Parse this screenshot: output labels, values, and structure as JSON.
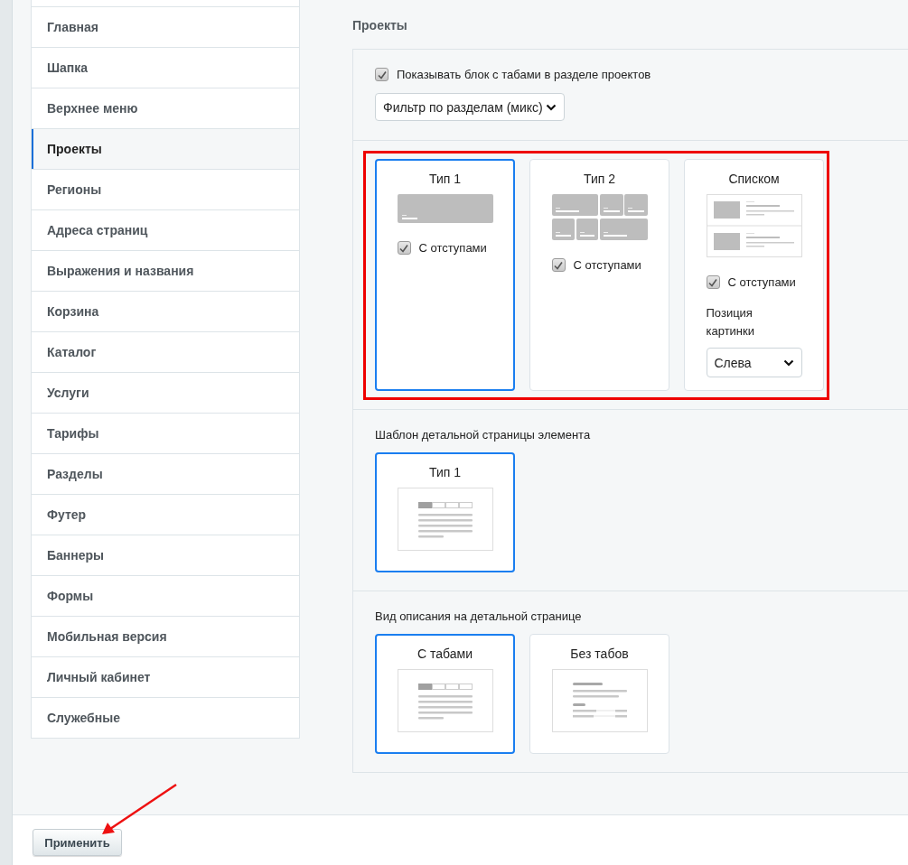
{
  "sidebar": {
    "items": [
      {
        "label": "Главная",
        "selected": false
      },
      {
        "label": "Шапка",
        "selected": false
      },
      {
        "label": "Верхнее меню",
        "selected": false
      },
      {
        "label": "Проекты",
        "selected": true
      },
      {
        "label": "Регионы",
        "selected": false
      },
      {
        "label": "Адреса страниц",
        "selected": false
      },
      {
        "label": "Выражения и названия",
        "selected": false
      },
      {
        "label": "Корзина",
        "selected": false
      },
      {
        "label": "Каталог",
        "selected": false
      },
      {
        "label": "Услуги",
        "selected": false
      },
      {
        "label": "Тарифы",
        "selected": false
      },
      {
        "label": "Разделы",
        "selected": false
      },
      {
        "label": "Футер",
        "selected": false
      },
      {
        "label": "Баннеры",
        "selected": false
      },
      {
        "label": "Формы",
        "selected": false
      },
      {
        "label": "Мобильная версия",
        "selected": false
      },
      {
        "label": "Личный кабинет",
        "selected": false
      },
      {
        "label": "Служебные",
        "selected": false
      }
    ]
  },
  "section_title": "Проекты",
  "panel": {
    "show_tabs": {
      "label": "Показывать блок с табами в разделе проектов",
      "checked": true
    },
    "filter_select": {
      "value": "Фильтр по разделам (микс)"
    },
    "list_types": [
      {
        "title": "Тип 1",
        "kind": "banner",
        "selected": true,
        "padding_checkbox": {
          "label": "С отступами",
          "checked": true
        }
      },
      {
        "title": "Тип 2",
        "kind": "grid",
        "selected": false,
        "padding_checkbox": {
          "label": "С отступами",
          "checked": true
        }
      },
      {
        "title": "Списком",
        "kind": "list",
        "selected": false,
        "padding_checkbox": {
          "label": "С отступами",
          "checked": true
        },
        "position_label": "Позиция картинки",
        "position_select": {
          "value": "Слева"
        }
      }
    ],
    "detail_template": {
      "label": "Шаблон детальной страницы элемента",
      "options": [
        {
          "title": "Тип 1",
          "kind": "tabs",
          "selected": true
        }
      ]
    },
    "description_view": {
      "label": "Вид описания на детальной странице",
      "options": [
        {
          "title": "С табами",
          "kind": "tabs",
          "selected": true
        },
        {
          "title": "Без табов",
          "kind": "plain",
          "selected": false
        }
      ]
    }
  },
  "apply_button": {
    "label": "Применить"
  }
}
